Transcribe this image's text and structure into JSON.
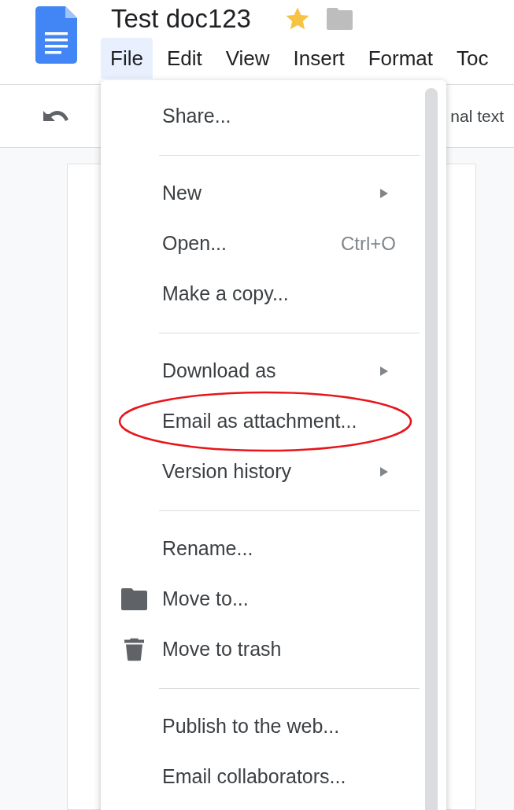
{
  "document": {
    "title": "Test doc123",
    "starred": true
  },
  "menu_bar": [
    {
      "label": "File",
      "selected": true
    },
    {
      "label": "Edit",
      "selected": false
    },
    {
      "label": "View",
      "selected": false
    },
    {
      "label": "Insert",
      "selected": false
    },
    {
      "label": "Format",
      "selected": false
    },
    {
      "label": "Toc",
      "selected": false
    }
  ],
  "toolbar": {
    "style_text": "nal text"
  },
  "file_menu": {
    "groups": [
      [
        {
          "label": "Share...",
          "submenu": false,
          "circled": false
        }
      ],
      [
        {
          "label": "New",
          "submenu": true,
          "circled": false
        },
        {
          "label": "Open...",
          "shortcut": "Ctrl+O",
          "submenu": false,
          "circled": false
        },
        {
          "label": "Make a copy...",
          "submenu": false,
          "circled": false
        }
      ],
      [
        {
          "label": "Download as",
          "submenu": true,
          "circled": false
        },
        {
          "label": "Email as attachment...",
          "submenu": false,
          "circled": true
        },
        {
          "label": "Version history",
          "submenu": true,
          "circled": false
        }
      ],
      [
        {
          "label": "Rename...",
          "submenu": false,
          "circled": false
        },
        {
          "label": "Move to...",
          "kind": "folder",
          "submenu": false,
          "circled": false
        },
        {
          "label": "Move to trash",
          "kind": "trash",
          "submenu": false,
          "circled": false
        }
      ],
      [
        {
          "label": "Publish to the web...",
          "submenu": false,
          "circled": false
        },
        {
          "label": "Email collaborators...",
          "submenu": false,
          "circled": false
        }
      ]
    ]
  }
}
